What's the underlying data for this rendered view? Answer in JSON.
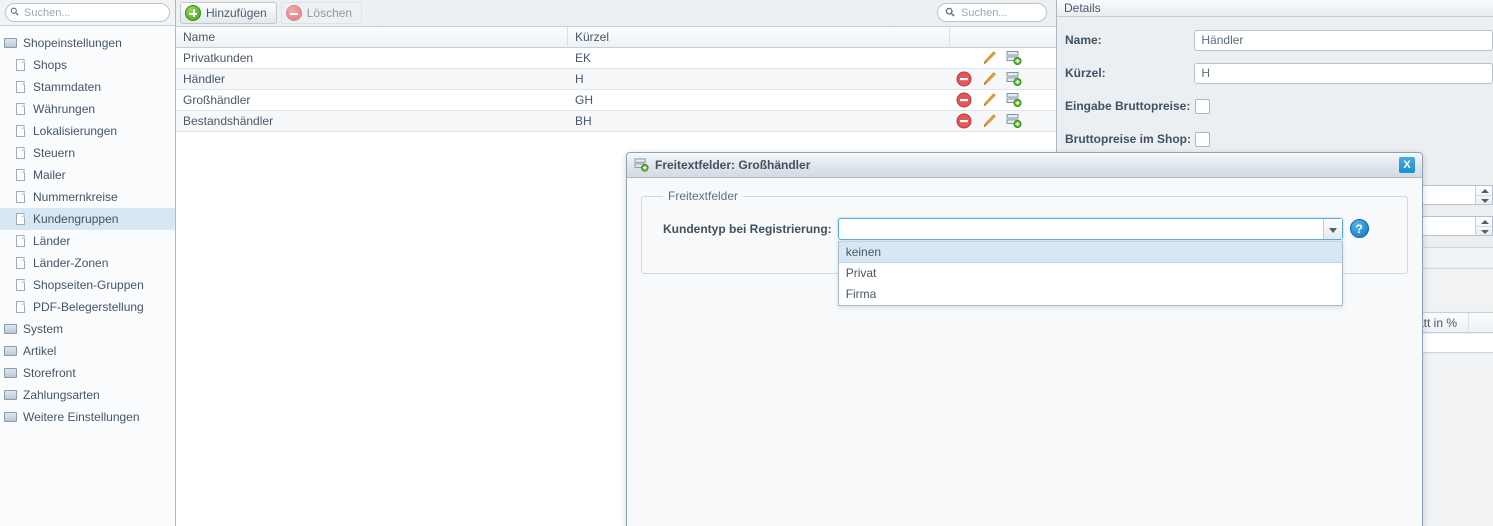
{
  "sidebar": {
    "search": {
      "placeholder": "Suchen...",
      "value": ""
    },
    "items": [
      {
        "label": "Shopeinstellungen",
        "type": "folder",
        "level": 0,
        "selected": false
      },
      {
        "label": "Shops",
        "type": "file",
        "level": 1,
        "selected": false
      },
      {
        "label": "Stammdaten",
        "type": "file",
        "level": 1,
        "selected": false
      },
      {
        "label": "Währungen",
        "type": "file",
        "level": 1,
        "selected": false
      },
      {
        "label": "Lokalisierungen",
        "type": "file",
        "level": 1,
        "selected": false
      },
      {
        "label": "Steuern",
        "type": "file",
        "level": 1,
        "selected": false
      },
      {
        "label": "Mailer",
        "type": "file",
        "level": 1,
        "selected": false
      },
      {
        "label": "Nummernkreise",
        "type": "file",
        "level": 1,
        "selected": false
      },
      {
        "label": "Kundengruppen",
        "type": "file",
        "level": 1,
        "selected": true
      },
      {
        "label": "Länder",
        "type": "file",
        "level": 1,
        "selected": false
      },
      {
        "label": "Länder-Zonen",
        "type": "file",
        "level": 1,
        "selected": false
      },
      {
        "label": "Shopseiten-Gruppen",
        "type": "file",
        "level": 1,
        "selected": false
      },
      {
        "label": "PDF-Belegerstellung",
        "type": "file",
        "level": 1,
        "selected": false
      },
      {
        "label": "System",
        "type": "folder",
        "level": 0,
        "selected": false
      },
      {
        "label": "Artikel",
        "type": "folder",
        "level": 0,
        "selected": false
      },
      {
        "label": "Storefront",
        "type": "folder",
        "level": 0,
        "selected": false
      },
      {
        "label": "Zahlungsarten",
        "type": "folder",
        "level": 0,
        "selected": false
      },
      {
        "label": "Weitere Einstellungen",
        "type": "folder",
        "level": 0,
        "selected": false
      }
    ]
  },
  "toolbar": {
    "add_label": "Hinzufügen",
    "delete_label": "Löschen",
    "search": {
      "placeholder": "Suchen...",
      "value": ""
    }
  },
  "grid": {
    "columns": [
      "Name",
      "Kürzel",
      ""
    ],
    "rows": [
      {
        "name": "Privatkunden",
        "kuerzel": "EK",
        "can_delete": false
      },
      {
        "name": "Händler",
        "kuerzel": "H",
        "can_delete": true
      },
      {
        "name": "Großhändler",
        "kuerzel": "GH",
        "can_delete": true
      },
      {
        "name": "Bestandshändler",
        "kuerzel": "BH",
        "can_delete": true
      }
    ]
  },
  "details": {
    "title": "Details",
    "fields": {
      "name_label": "Name:",
      "name_value": "Händler",
      "kuerzel_label": "Kürzel:",
      "kuerzel_value": "H",
      "eingabe_brutto_label": "Eingabe Bruttopreise:",
      "brutto_shop_label": "Bruttopreise im Shop:"
    },
    "background_column_header": "att in %"
  },
  "dialog": {
    "title": "Freitextfelder: Großhändler",
    "close_label": "X",
    "fieldset_legend": "Freitextfelder",
    "field_label": "Kundentyp bei Registrierung:",
    "field_value": "",
    "help_label": "?",
    "options": [
      {
        "label": "keinen",
        "selected": true
      },
      {
        "label": "Privat",
        "selected": false
      },
      {
        "label": "Firma",
        "selected": false
      }
    ]
  },
  "colors": {
    "accent_blue": "#1a8fd4",
    "selection_blue": "#d7e7f4",
    "text": "#47596b",
    "green": "#46a017",
    "red": "#e07d7d",
    "orange": "#e8a33d"
  }
}
